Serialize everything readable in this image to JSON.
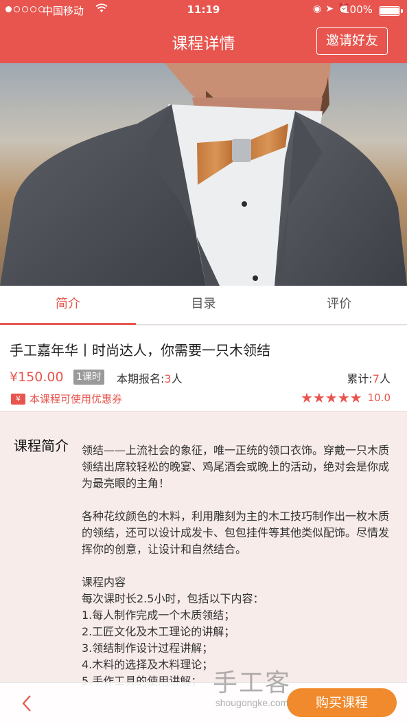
{
  "status_bar": {
    "carrier": "中国移动",
    "time": "11:19",
    "battery": "100%"
  },
  "nav": {
    "title": "课程详情",
    "invite_label": "邀请好友"
  },
  "carousel": {
    "slide_count": 7,
    "active_index": 0
  },
  "tabs": [
    {
      "label": "简介",
      "active": true
    },
    {
      "label": "目录",
      "active": false
    },
    {
      "label": "评价",
      "active": false
    }
  ],
  "course": {
    "title": "手工嘉年华丨时尚达人，你需要一只木领结",
    "price": "¥150.00",
    "lessons": "1课时",
    "enroll_label": "本期报名:",
    "enroll_count": "3",
    "enroll_unit": "人",
    "total_label": "累计:",
    "total_count": "7",
    "total_unit": "人",
    "coupon_icon": "¥",
    "coupon_text": "本课程可使用优惠券",
    "stars": "★★★★★",
    "rating_value": "10.0"
  },
  "description": {
    "heading": "课程简介",
    "paragraph1": "领结——上流社会的象征，唯一正统的领口衣饰。穿戴一只木质领结出席较轻松的晚宴、鸡尾酒会或晚上的活动，绝对会是你成为最亮眼的主角！",
    "paragraph2": "各种花纹颜色的木料，利用雕刻为主的木工技巧制作出一枚木质的领结，还可以设计成发卡、包包挂件等其他类似配饰。尽情发挥你的创意，让设计和自然结合。",
    "content_title": "课程内容",
    "content_lines": [
      "每次课时长2.5小时，包括以下内容：",
      "1.每人制作完成一个木质领结；",
      "2.工匠文化及木工理论的讲解；",
      "3.领结制作设计过程讲解；",
      "4.木料的选择及木料理论；",
      "5.手作工具的使用讲解；"
    ]
  },
  "bottom": {
    "buy_label": "购买课程"
  },
  "watermark": {
    "cn": "手工客",
    "en": "shougongke.com"
  },
  "colors": {
    "primary": "#e8554e",
    "buy_button": "#f08a2c",
    "background": "#f7ecea"
  },
  "icons": [
    "wifi-icon",
    "location-icon",
    "alarm-icon",
    "battery-icon",
    "coupon-icon",
    "star-icon",
    "back-arrow-icon"
  ]
}
